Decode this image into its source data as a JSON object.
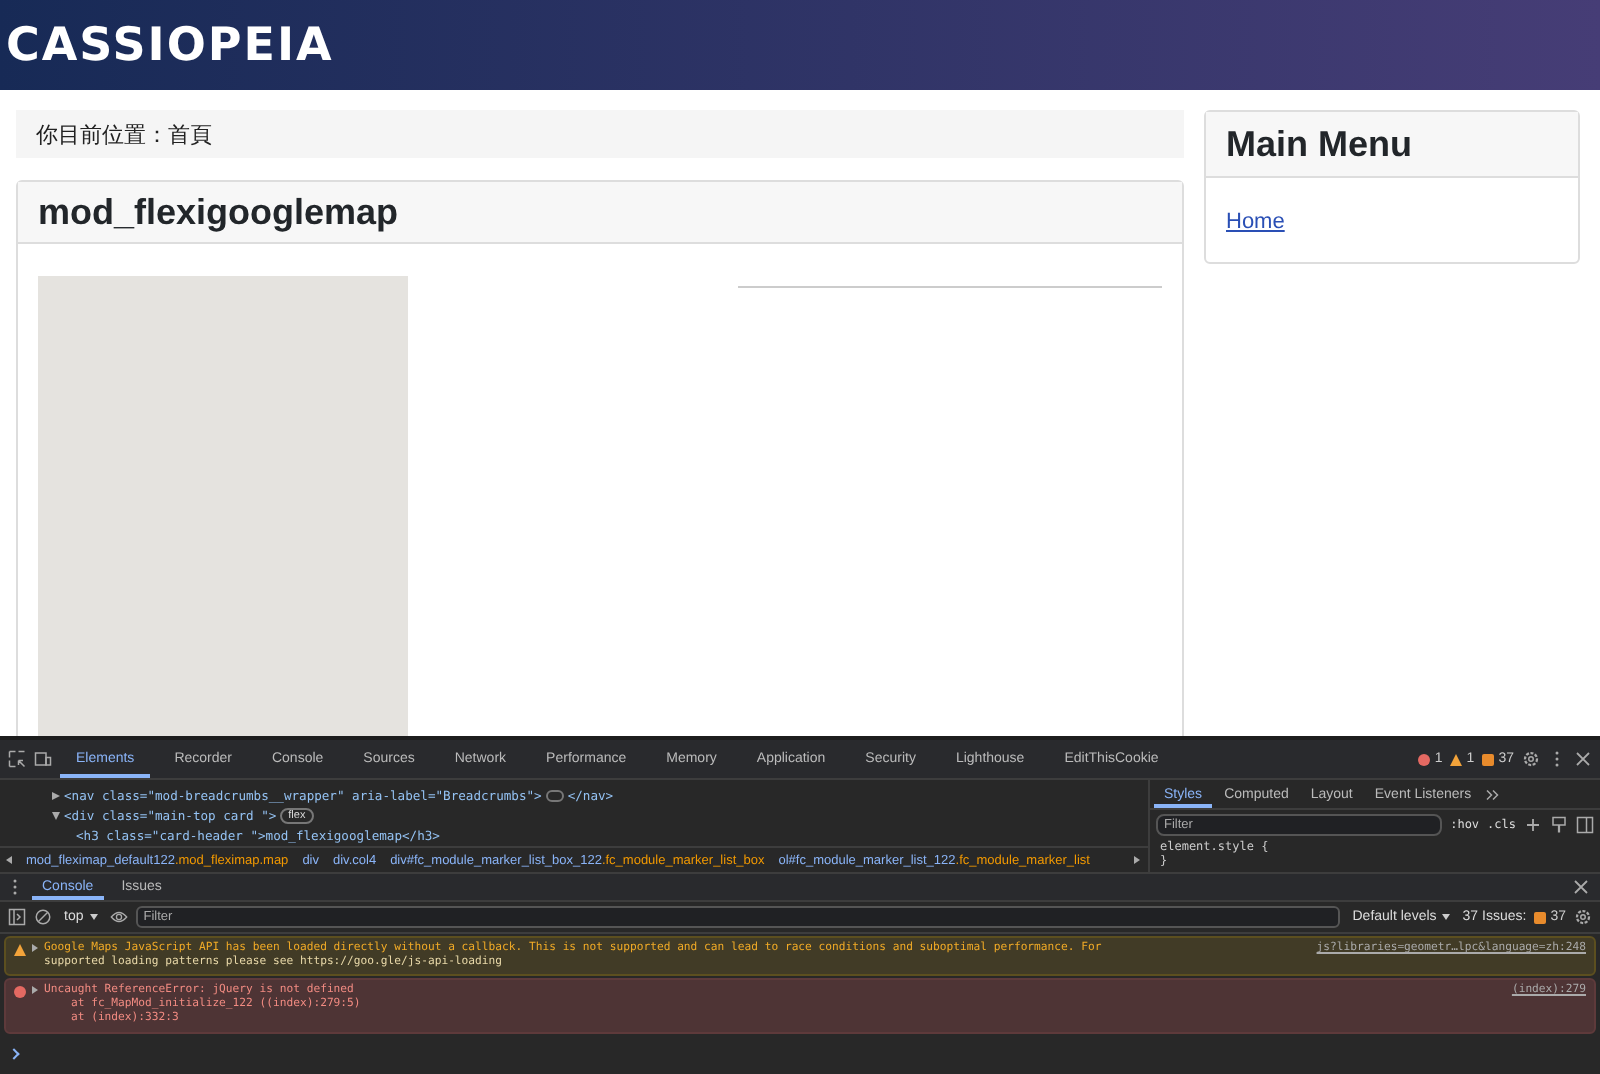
{
  "site": {
    "logo": "CASSIOPEIA"
  },
  "breadcrumb": {
    "text": "你目前位置：首頁"
  },
  "card": {
    "title": "mod_flexigooglemap"
  },
  "sidebar": {
    "title": "Main Menu",
    "items": [
      {
        "label": "Home"
      }
    ]
  },
  "devtools": {
    "tabs": [
      {
        "label": "Elements",
        "selected": true
      },
      {
        "label": "Recorder",
        "selected": false
      },
      {
        "label": "Console",
        "selected": false
      },
      {
        "label": "Sources",
        "selected": false
      },
      {
        "label": "Network",
        "selected": false
      },
      {
        "label": "Performance",
        "selected": false
      },
      {
        "label": "Memory",
        "selected": false
      },
      {
        "label": "Application",
        "selected": false
      },
      {
        "label": "Security",
        "selected": false
      },
      {
        "label": "Lighthouse",
        "selected": false
      },
      {
        "label": "EditThisCookie",
        "selected": false
      }
    ],
    "errors": "1",
    "warnings": "1",
    "issues": "37",
    "dom_lines": [
      {
        "text": "<nav class=\"mod-breadcrumbs__wrapper\" aria-label=\"Breadcrumbs\">",
        "tail": "</nav>",
        "expanded": false
      },
      {
        "text": "<div class=\"main-top card \">",
        "badge": "flex",
        "expanded": true
      },
      {
        "text": "<h3 class=\"card-header \">mod_flexigooglemap</h3>"
      }
    ],
    "path": [
      {
        "tag": "mod_fleximap_default122",
        "cls": ".mod_fleximap.map"
      },
      {
        "tag": "div"
      },
      {
        "tag": "div.col4"
      },
      {
        "tag": "div#fc_module_marker_list_box_122",
        "cls": ".fc_module_marker_list_box"
      },
      {
        "tag": "ol#fc_module_marker_list_122",
        "cls": ".fc_module_marker_list"
      }
    ],
    "styles_tabs": [
      {
        "label": "Styles",
        "selected": true
      },
      {
        "label": "Computed",
        "selected": false
      },
      {
        "label": "Layout",
        "selected": false
      },
      {
        "label": "Event Listeners",
        "selected": false
      }
    ],
    "styles_filter": {
      "placeholder": "Filter"
    },
    "hov": ":hov",
    "cls": ".cls",
    "styles_rule": [
      "element.style {",
      "}"
    ],
    "drawer_tabs": [
      {
        "label": "Console",
        "selected": true
      },
      {
        "label": "Issues",
        "selected": false
      }
    ],
    "context": "top",
    "console_filter": {
      "placeholder": "Filter"
    },
    "levels": "Default levels",
    "issues_label": "37 Issues:",
    "issues_count": "37",
    "messages": [
      {
        "kind": "warning",
        "lines": [
          "Google Maps JavaScript API has been loaded directly without a callback. This is not supported and can lead to race conditions and suboptimal performance. For",
          "supported loading patterns please see https://goo.gle/js-api-loading"
        ],
        "source": "js?libraries=geometr…lpc&language=zh:248"
      },
      {
        "kind": "error",
        "lines": [
          "Uncaught ReferenceError: jQuery is not defined",
          "    at fc_MapMod_initialize_122 ((index):279:5)",
          "    at (index):332:3"
        ],
        "source": "(index):279"
      }
    ]
  }
}
